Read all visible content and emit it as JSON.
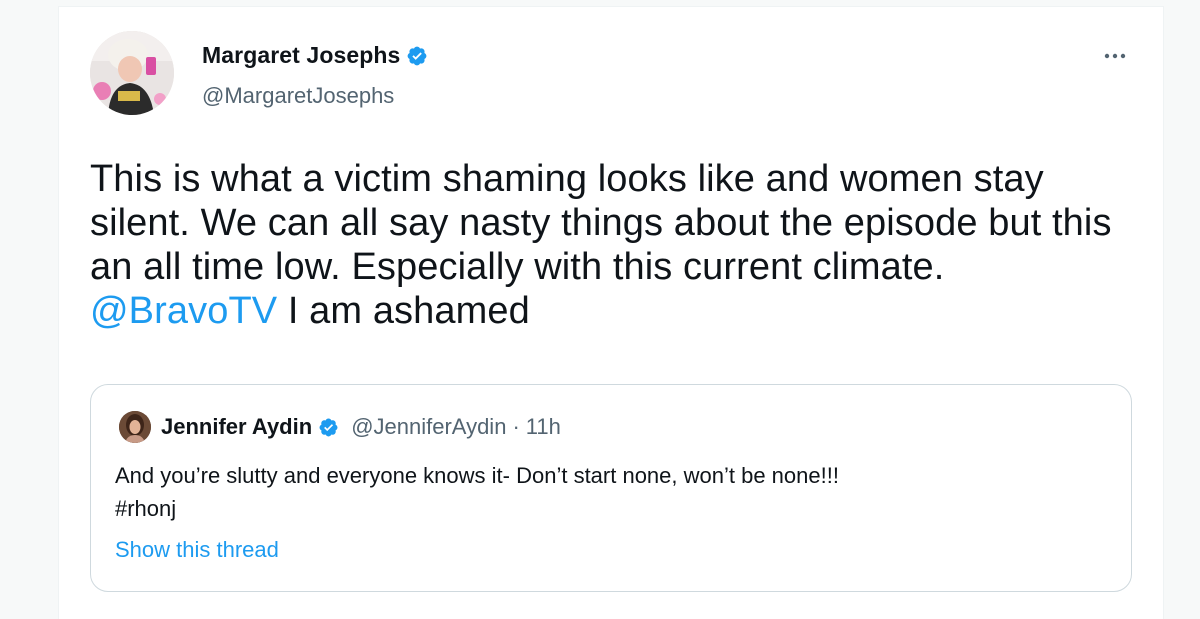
{
  "tweet": {
    "author": {
      "display_name": "Margaret Josephs",
      "handle": "@MargaretJosephs",
      "verified": true,
      "avatar_icon": "profile-photo"
    },
    "more_icon": "more-horizontal-icon",
    "text_parts": {
      "before_mention": "This is what a victim shaming looks like and women stay silent. We can all say nasty things about the episode but this an all time low. Especially with this current climate. ",
      "mention": "@BravoTV",
      "after_mention": " I am ashamed"
    },
    "quoted_tweet": {
      "display_name": "Jennifer Aydin",
      "handle": "@JenniferAydin",
      "separator": "·",
      "time": "11h",
      "verified": true,
      "text_line1": "And you’re slutty and everyone knows it- Don’t start none, won’t be none!!!",
      "text_line2": "#rhonj",
      "show_thread_label": "Show this thread"
    }
  },
  "colors": {
    "text_primary": "#0f1419",
    "text_secondary": "#536471",
    "accent_blue": "#1d9bf0",
    "border": "#cfd9de",
    "page_background": "#f7f9f9"
  }
}
